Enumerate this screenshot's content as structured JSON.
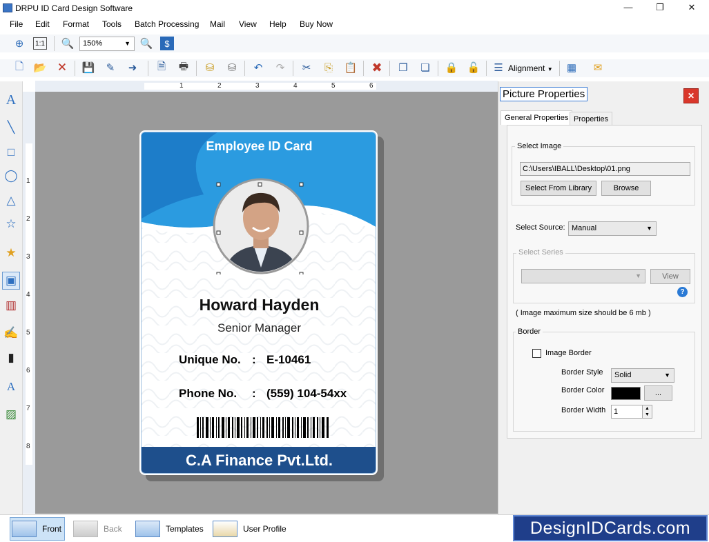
{
  "window": {
    "title": "DRPU ID Card Design Software",
    "minimize": "—",
    "maximize": "❐",
    "close": "✕"
  },
  "menu": [
    "File",
    "Edit",
    "Format",
    "Tools",
    "Batch Processing",
    "Mail",
    "View",
    "Help",
    "Buy Now"
  ],
  "toolbar": {
    "zoom_value": "150%",
    "alignment_label": "Alignment"
  },
  "ruler": {
    "h_numbers": [
      "1",
      "2",
      "3",
      "4",
      "5",
      "6"
    ],
    "v_numbers": [
      "1",
      "2",
      "3",
      "4",
      "5",
      "6",
      "7",
      "8"
    ]
  },
  "card": {
    "header_title": "Employee ID Card",
    "name": "Howard Hayden",
    "designation": "Senior Manager",
    "unique_label": "Unique No.",
    "unique_sep": ":",
    "unique_value": "E-10461",
    "phone_label": "Phone No.",
    "phone_sep": ":",
    "phone_value": "(559) 104-54xx",
    "company": "C.A Finance Pvt.Ltd.",
    "colors": {
      "header_blue": "#2b9be0",
      "footer_blue": "#1e4f8c"
    }
  },
  "panel": {
    "title": "Picture Properties",
    "tabs": [
      "General Properties",
      "Properties"
    ],
    "select_image_label": "Select Image",
    "image_path": "C:\\Users\\IBALL\\Desktop\\01.png",
    "select_library_btn": "Select From Library",
    "browse_btn": "Browse",
    "select_source_label": "Select Source:",
    "select_source_value": "Manual",
    "select_series_label": "Select Series",
    "view_btn": "View",
    "help_icon": "?",
    "image_note": "( Image maximum size should be 6 mb )",
    "border_label": "Border",
    "image_border_label": "Image Border",
    "border_style_label": "Border Style",
    "border_style_value": "Solid",
    "border_color_label": "Border Color",
    "border_color_value": "#000000",
    "color_btn": "...",
    "border_width_label": "Border Width",
    "border_width_value": "1"
  },
  "status": {
    "front": "Front",
    "back": "Back",
    "templates": "Templates",
    "user_profile": "User Profile",
    "brand": "DesignIDCards.com"
  }
}
